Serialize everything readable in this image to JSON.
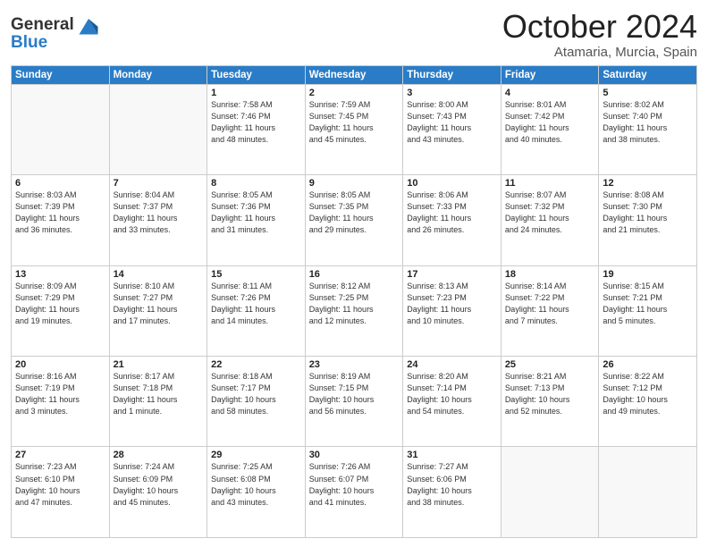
{
  "header": {
    "logo_line1": "General",
    "logo_line2": "Blue",
    "title": "October 2024",
    "subtitle": "Atamaria, Murcia, Spain"
  },
  "columns": [
    "Sunday",
    "Monday",
    "Tuesday",
    "Wednesday",
    "Thursday",
    "Friday",
    "Saturday"
  ],
  "weeks": [
    [
      {
        "day": "",
        "info": ""
      },
      {
        "day": "",
        "info": ""
      },
      {
        "day": "1",
        "info": "Sunrise: 7:58 AM\nSunset: 7:46 PM\nDaylight: 11 hours\nand 48 minutes."
      },
      {
        "day": "2",
        "info": "Sunrise: 7:59 AM\nSunset: 7:45 PM\nDaylight: 11 hours\nand 45 minutes."
      },
      {
        "day": "3",
        "info": "Sunrise: 8:00 AM\nSunset: 7:43 PM\nDaylight: 11 hours\nand 43 minutes."
      },
      {
        "day": "4",
        "info": "Sunrise: 8:01 AM\nSunset: 7:42 PM\nDaylight: 11 hours\nand 40 minutes."
      },
      {
        "day": "5",
        "info": "Sunrise: 8:02 AM\nSunset: 7:40 PM\nDaylight: 11 hours\nand 38 minutes."
      }
    ],
    [
      {
        "day": "6",
        "info": "Sunrise: 8:03 AM\nSunset: 7:39 PM\nDaylight: 11 hours\nand 36 minutes."
      },
      {
        "day": "7",
        "info": "Sunrise: 8:04 AM\nSunset: 7:37 PM\nDaylight: 11 hours\nand 33 minutes."
      },
      {
        "day": "8",
        "info": "Sunrise: 8:05 AM\nSunset: 7:36 PM\nDaylight: 11 hours\nand 31 minutes."
      },
      {
        "day": "9",
        "info": "Sunrise: 8:05 AM\nSunset: 7:35 PM\nDaylight: 11 hours\nand 29 minutes."
      },
      {
        "day": "10",
        "info": "Sunrise: 8:06 AM\nSunset: 7:33 PM\nDaylight: 11 hours\nand 26 minutes."
      },
      {
        "day": "11",
        "info": "Sunrise: 8:07 AM\nSunset: 7:32 PM\nDaylight: 11 hours\nand 24 minutes."
      },
      {
        "day": "12",
        "info": "Sunrise: 8:08 AM\nSunset: 7:30 PM\nDaylight: 11 hours\nand 21 minutes."
      }
    ],
    [
      {
        "day": "13",
        "info": "Sunrise: 8:09 AM\nSunset: 7:29 PM\nDaylight: 11 hours\nand 19 minutes."
      },
      {
        "day": "14",
        "info": "Sunrise: 8:10 AM\nSunset: 7:27 PM\nDaylight: 11 hours\nand 17 minutes."
      },
      {
        "day": "15",
        "info": "Sunrise: 8:11 AM\nSunset: 7:26 PM\nDaylight: 11 hours\nand 14 minutes."
      },
      {
        "day": "16",
        "info": "Sunrise: 8:12 AM\nSunset: 7:25 PM\nDaylight: 11 hours\nand 12 minutes."
      },
      {
        "day": "17",
        "info": "Sunrise: 8:13 AM\nSunset: 7:23 PM\nDaylight: 11 hours\nand 10 minutes."
      },
      {
        "day": "18",
        "info": "Sunrise: 8:14 AM\nSunset: 7:22 PM\nDaylight: 11 hours\nand 7 minutes."
      },
      {
        "day": "19",
        "info": "Sunrise: 8:15 AM\nSunset: 7:21 PM\nDaylight: 11 hours\nand 5 minutes."
      }
    ],
    [
      {
        "day": "20",
        "info": "Sunrise: 8:16 AM\nSunset: 7:19 PM\nDaylight: 11 hours\nand 3 minutes."
      },
      {
        "day": "21",
        "info": "Sunrise: 8:17 AM\nSunset: 7:18 PM\nDaylight: 11 hours\nand 1 minute."
      },
      {
        "day": "22",
        "info": "Sunrise: 8:18 AM\nSunset: 7:17 PM\nDaylight: 10 hours\nand 58 minutes."
      },
      {
        "day": "23",
        "info": "Sunrise: 8:19 AM\nSunset: 7:15 PM\nDaylight: 10 hours\nand 56 minutes."
      },
      {
        "day": "24",
        "info": "Sunrise: 8:20 AM\nSunset: 7:14 PM\nDaylight: 10 hours\nand 54 minutes."
      },
      {
        "day": "25",
        "info": "Sunrise: 8:21 AM\nSunset: 7:13 PM\nDaylight: 10 hours\nand 52 minutes."
      },
      {
        "day": "26",
        "info": "Sunrise: 8:22 AM\nSunset: 7:12 PM\nDaylight: 10 hours\nand 49 minutes."
      }
    ],
    [
      {
        "day": "27",
        "info": "Sunrise: 7:23 AM\nSunset: 6:10 PM\nDaylight: 10 hours\nand 47 minutes."
      },
      {
        "day": "28",
        "info": "Sunrise: 7:24 AM\nSunset: 6:09 PM\nDaylight: 10 hours\nand 45 minutes."
      },
      {
        "day": "29",
        "info": "Sunrise: 7:25 AM\nSunset: 6:08 PM\nDaylight: 10 hours\nand 43 minutes."
      },
      {
        "day": "30",
        "info": "Sunrise: 7:26 AM\nSunset: 6:07 PM\nDaylight: 10 hours\nand 41 minutes."
      },
      {
        "day": "31",
        "info": "Sunrise: 7:27 AM\nSunset: 6:06 PM\nDaylight: 10 hours\nand 38 minutes."
      },
      {
        "day": "",
        "info": ""
      },
      {
        "day": "",
        "info": ""
      }
    ]
  ]
}
